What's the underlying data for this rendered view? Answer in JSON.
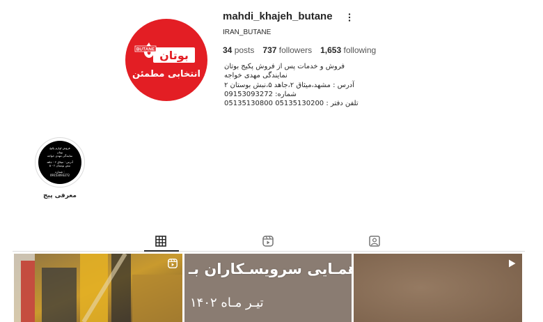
{
  "profile": {
    "username": "mahdi_khajeh_butane",
    "full_name": "IRAN_BUTANE",
    "avatar_logo_latin": "BUTANE",
    "avatar_logo_persian": "بوتان",
    "avatar_tagline": "انتخابی مطمئن",
    "stats": {
      "posts_count": "34",
      "posts_label": "posts",
      "followers_count": "737",
      "followers_label": "followers",
      "following_count": "1,653",
      "following_label": "following"
    },
    "bio": [
      "فروش و خدمات پس از فروش پکیج بوتان",
      "نمایندگی مهدی خواجه",
      "آدرس : مشهد،میثاق ۲،جاهد ۵،نبش بوستان ۲",
      "شماره: 09153093272",
      "تلفن دفتر : 05135130200 05135130800"
    ]
  },
  "highlights": [
    {
      "label": "معرفی پیج",
      "cover_lines": [
        "فروش لوازم پکیج",
        "بوتان",
        "نمایندگی مهدی خواجه",
        "آدرس : میثاق ۲ - جاهد",
        "۵ - نبش بوستان ۲",
        "شماره :",
        "09153093272"
      ]
    }
  ],
  "tabs": [
    {
      "name": "posts",
      "icon": "grid-icon",
      "active": true
    },
    {
      "name": "reels",
      "icon": "reels-icon",
      "active": false
    },
    {
      "name": "tagged",
      "icon": "tagged-icon",
      "active": false
    }
  ],
  "posts": [
    {
      "type": "reel",
      "icon": "reels-icon"
    },
    {
      "type": "image",
      "overlay_title": "دهمـایی سرویسـکاران بـ",
      "overlay_date": "تیـر مـاه ۱۴۰۲"
    },
    {
      "type": "video",
      "icon": "play-icon"
    }
  ],
  "colors": {
    "brand_red": "#e31e24",
    "text": "#262626",
    "divider": "#dbdbdb"
  }
}
